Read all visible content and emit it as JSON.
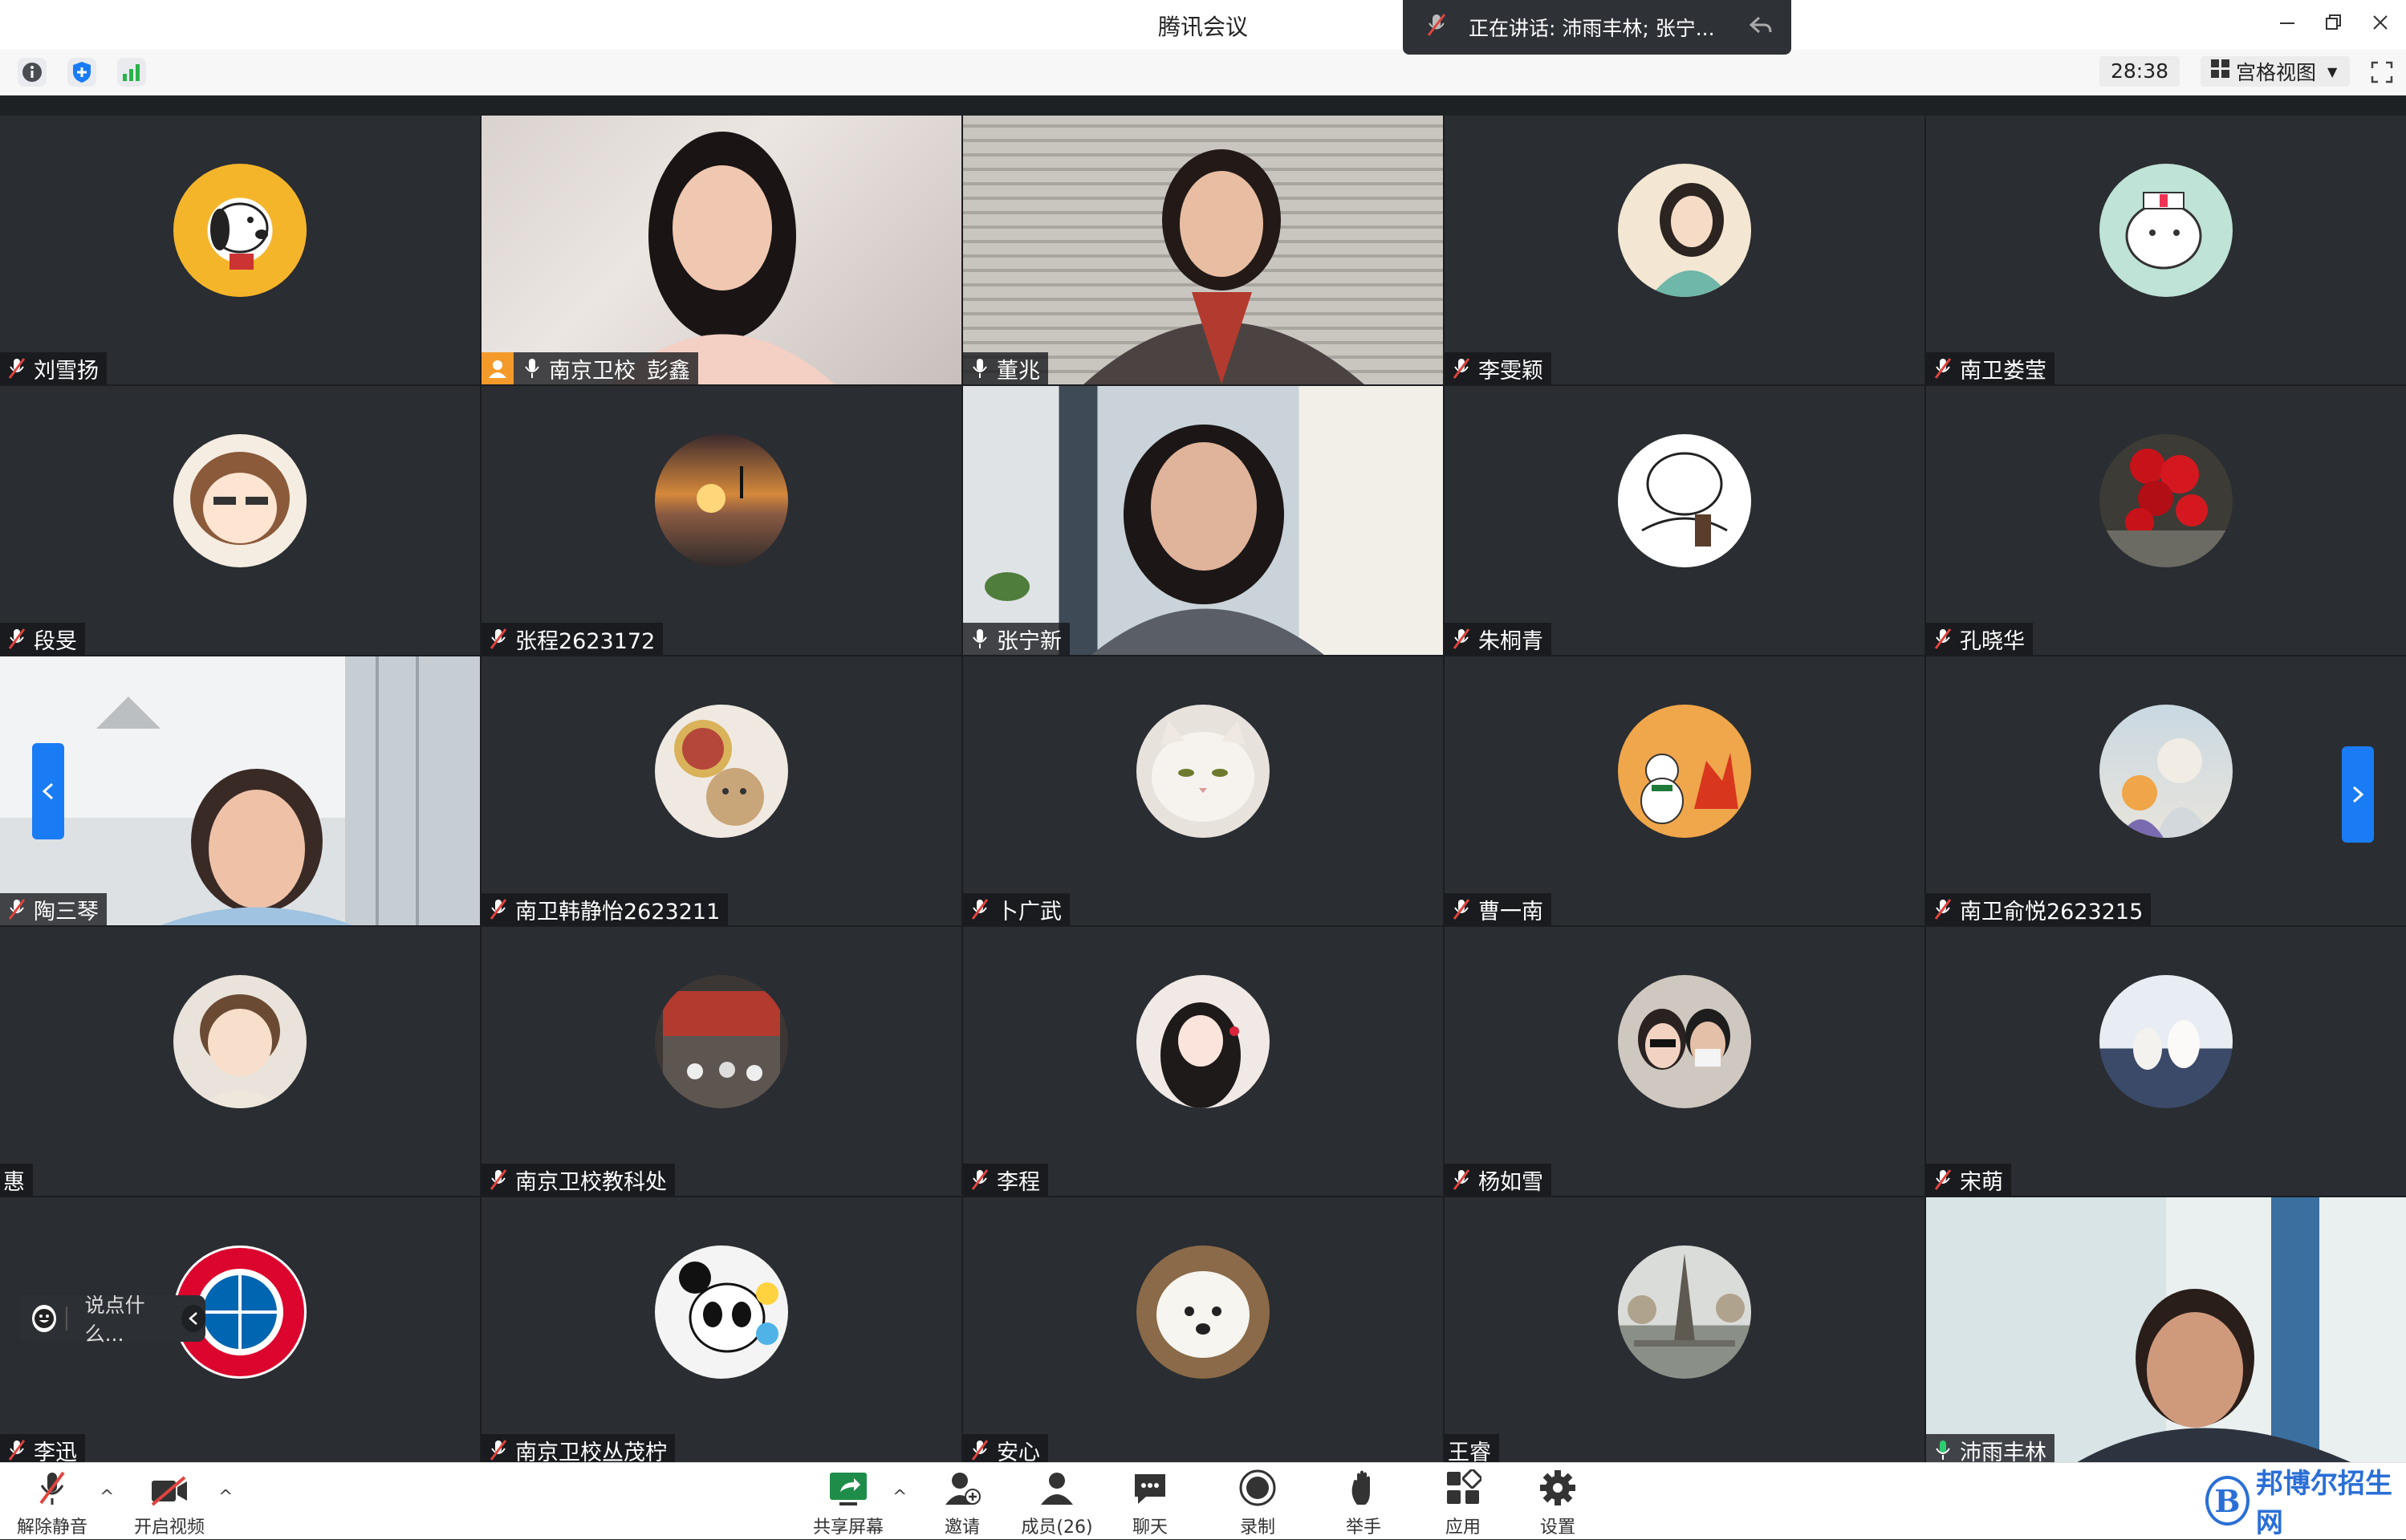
{
  "window": {
    "title": "腾讯会议",
    "speaking_label": "正在讲话: 沛雨丰林; 张宁..."
  },
  "toolbar": {
    "timer": "28:38",
    "view_mode": "宫格视图"
  },
  "participants": [
    {
      "name": "刘雪扬",
      "mic": "muted"
    },
    {
      "name": "彭鑫",
      "prefix": "南京卫校",
      "mic": "on",
      "host": true
    },
    {
      "name": "董兆",
      "mic": "on"
    },
    {
      "name": "李雯颖",
      "mic": "muted"
    },
    {
      "name": "南卫娄莹",
      "mic": "muted"
    },
    {
      "name": "段旻",
      "mic": "muted"
    },
    {
      "name": "张程2623172",
      "mic": "muted"
    },
    {
      "name": "张宁新",
      "mic": "on"
    },
    {
      "name": "朱桐青",
      "mic": "muted"
    },
    {
      "name": "孔晓华",
      "mic": "muted"
    },
    {
      "name": "陶三琴",
      "mic": "muted"
    },
    {
      "name": "南卫韩静怡2623211",
      "mic": "muted"
    },
    {
      "name": "卜广武",
      "mic": "muted"
    },
    {
      "name": "曹一南",
      "mic": "muted"
    },
    {
      "name": "南卫俞悦2623215",
      "mic": "muted"
    },
    {
      "name": "惠",
      "mic": "none"
    },
    {
      "name": "南京卫校教科处",
      "mic": "muted"
    },
    {
      "name": "李程",
      "mic": "muted"
    },
    {
      "name": "杨如雪",
      "mic": "muted"
    },
    {
      "name": "宋萌",
      "mic": "muted"
    },
    {
      "name": "李迅",
      "mic": "muted"
    },
    {
      "name": "南京卫校丛茂柠",
      "mic": "muted"
    },
    {
      "name": "安心",
      "mic": "muted"
    },
    {
      "name": "王睿",
      "mic": "none"
    },
    {
      "name": "沛雨丰林",
      "mic": "speaking"
    }
  ],
  "chat": {
    "placeholder": "说点什么..."
  },
  "bottombar": {
    "unmute": "解除静音",
    "start_video": "开启视频",
    "share_screen": "共享屏幕",
    "invite": "邀请",
    "members": "成员(26)",
    "chat": "聊天",
    "record": "录制",
    "raise_hand": "举手",
    "apps": "应用",
    "settings": "设置"
  },
  "watermark": {
    "logo_letter": "B",
    "text": "邦博尔招生网"
  },
  "colors": {
    "accent": "#1a7cf5",
    "muted_red": "#e0443e",
    "speaking_green": "#2ecc71",
    "host_orange": "#f39a2b"
  }
}
